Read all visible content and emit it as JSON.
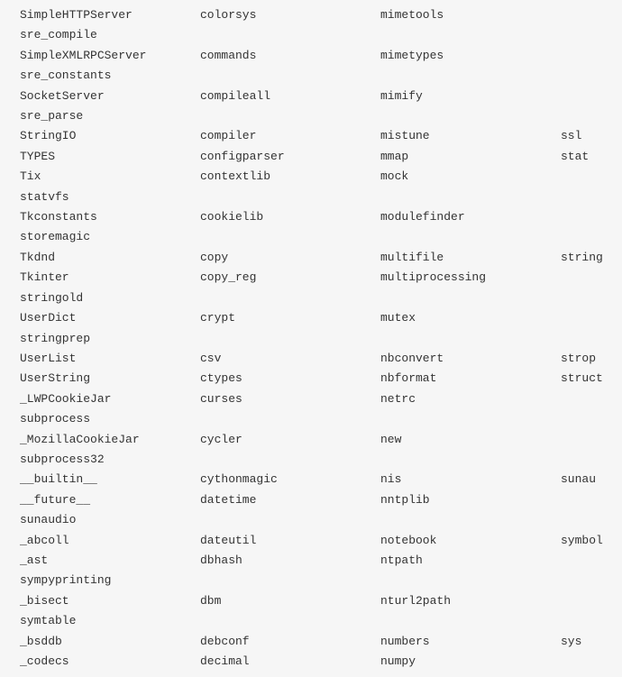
{
  "rows": [
    {
      "c1": "SimpleHTTPServer",
      "c2": "colorsys",
      "c3": "mimetools",
      "c4": ""
    },
    {
      "c1": "sre_compile",
      "c2": "",
      "c3": "",
      "c4": ""
    },
    {
      "c1": "SimpleXMLRPCServer",
      "c2": "commands",
      "c3": "mimetypes",
      "c4": ""
    },
    {
      "c1": "sre_constants",
      "c2": "",
      "c3": "",
      "c4": ""
    },
    {
      "c1": "SocketServer",
      "c2": "compileall",
      "c3": "mimify",
      "c4": ""
    },
    {
      "c1": "sre_parse",
      "c2": "",
      "c3": "",
      "c4": ""
    },
    {
      "c1": "StringIO",
      "c2": "compiler",
      "c3": "mistune",
      "c4": "ssl"
    },
    {
      "c1": "TYPES",
      "c2": "configparser",
      "c3": "mmap",
      "c4": "stat"
    },
    {
      "c1": "Tix",
      "c2": "contextlib",
      "c3": "mock",
      "c4": ""
    },
    {
      "c1": "statvfs",
      "c2": "",
      "c3": "",
      "c4": ""
    },
    {
      "c1": "Tkconstants",
      "c2": "cookielib",
      "c3": "modulefinder",
      "c4": ""
    },
    {
      "c1": "storemagic",
      "c2": "",
      "c3": "",
      "c4": ""
    },
    {
      "c1": "Tkdnd",
      "c2": "copy",
      "c3": "multifile",
      "c4": "string"
    },
    {
      "c1": "Tkinter",
      "c2": "copy_reg",
      "c3": "multiprocessing",
      "c4": ""
    },
    {
      "c1": "stringold",
      "c2": "",
      "c3": "",
      "c4": ""
    },
    {
      "c1": "UserDict",
      "c2": "crypt",
      "c3": "mutex",
      "c4": ""
    },
    {
      "c1": "stringprep",
      "c2": "",
      "c3": "",
      "c4": ""
    },
    {
      "c1": "UserList",
      "c2": "csv",
      "c3": "nbconvert",
      "c4": "strop"
    },
    {
      "c1": "UserString",
      "c2": "ctypes",
      "c3": "nbformat",
      "c4": "struct"
    },
    {
      "c1": "_LWPCookieJar",
      "c2": "curses",
      "c3": "netrc",
      "c4": ""
    },
    {
      "c1": "subprocess",
      "c2": "",
      "c3": "",
      "c4": ""
    },
    {
      "c1": "_MozillaCookieJar",
      "c2": "cycler",
      "c3": "new",
      "c4": ""
    },
    {
      "c1": "subprocess32",
      "c2": "",
      "c3": "",
      "c4": ""
    },
    {
      "c1": "__builtin__",
      "c2": "cythonmagic",
      "c3": "nis",
      "c4": "sunau"
    },
    {
      "c1": "__future__",
      "c2": "datetime",
      "c3": "nntplib",
      "c4": ""
    },
    {
      "c1": "sunaudio",
      "c2": "",
      "c3": "",
      "c4": ""
    },
    {
      "c1": "_abcoll",
      "c2": "dateutil",
      "c3": "notebook",
      "c4": "symbol"
    },
    {
      "c1": "_ast",
      "c2": "dbhash",
      "c3": "ntpath",
      "c4": ""
    },
    {
      "c1": "sympyprinting",
      "c2": "",
      "c3": "",
      "c4": ""
    },
    {
      "c1": "_bisect",
      "c2": "dbm",
      "c3": "nturl2path",
      "c4": ""
    },
    {
      "c1": "symtable",
      "c2": "",
      "c3": "",
      "c4": ""
    },
    {
      "c1": "_bsddb",
      "c2": "debconf",
      "c3": "numbers",
      "c4": "sys"
    },
    {
      "c1": "_codecs",
      "c2": "decimal",
      "c3": "numpy",
      "c4": ""
    }
  ]
}
